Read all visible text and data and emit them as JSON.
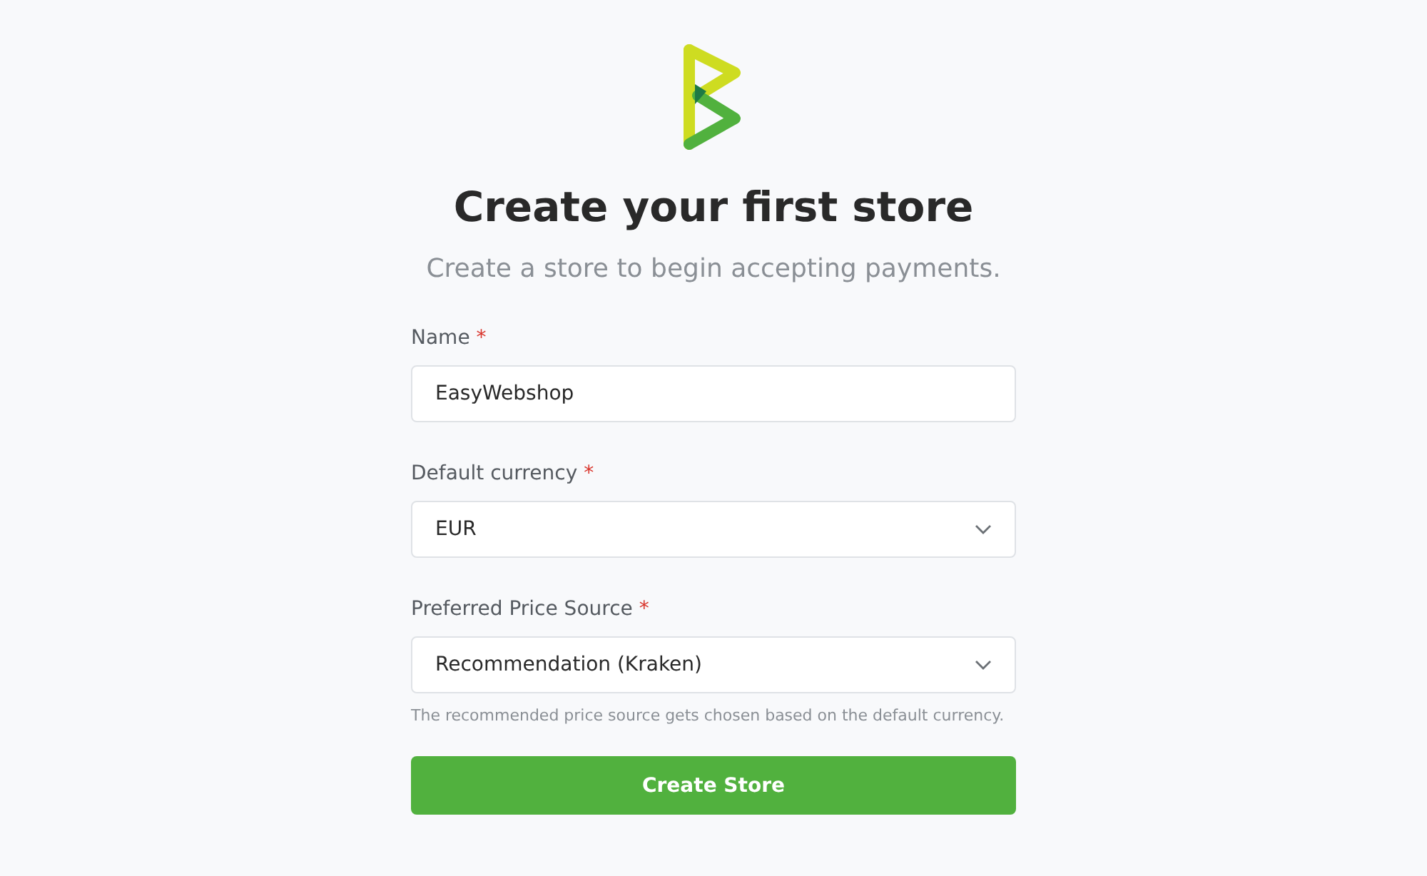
{
  "title": "Create your first store",
  "subtitle": "Create a store to begin accepting payments.",
  "fields": [
    {
      "kind": "text",
      "label": "Name",
      "required": "*",
      "value": "EasyWebshop"
    },
    {
      "kind": "select",
      "label": "Default currency",
      "required": "*",
      "value": "EUR"
    },
    {
      "kind": "select",
      "label": "Preferred Price Source",
      "required": "*",
      "value": "Recommendation (Kraken)",
      "help": "The recommended price source gets chosen based on the default currency."
    }
  ],
  "submit": "Create Store"
}
